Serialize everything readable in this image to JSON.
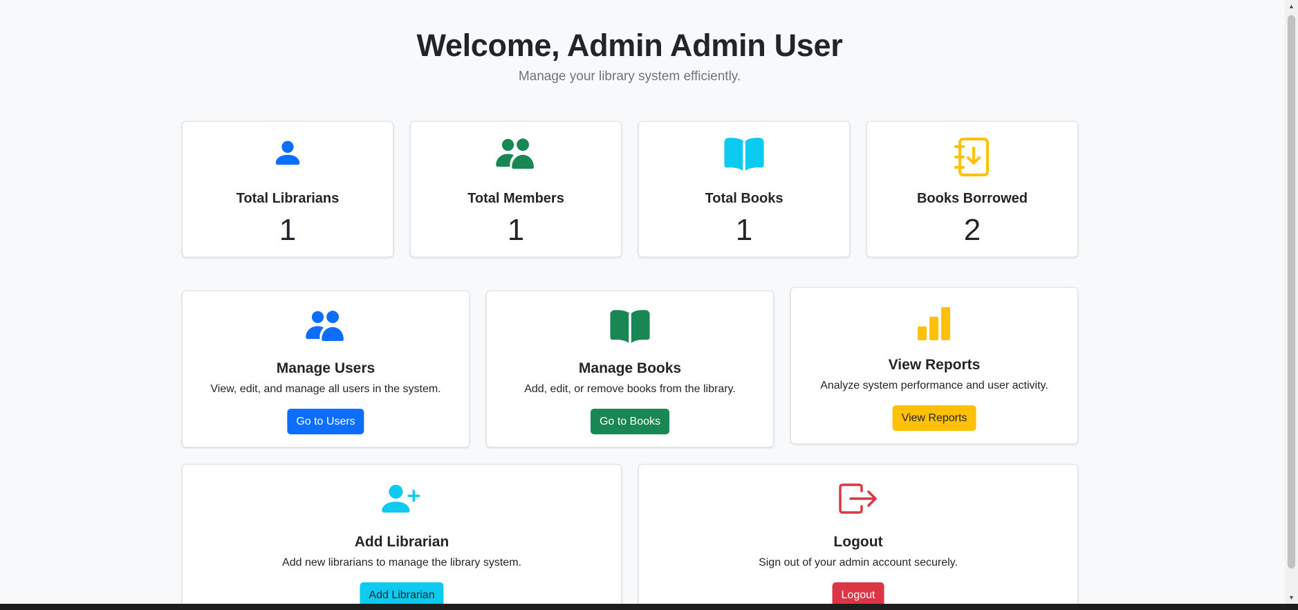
{
  "header": {
    "title": "Welcome, Admin Admin User",
    "subtitle": "Manage your library system efficiently."
  },
  "stats": [
    {
      "label": "Total Librarians",
      "value": "1",
      "icon": "person-icon",
      "color": "#0d6efd"
    },
    {
      "label": "Total Members",
      "value": "1",
      "icon": "people-icon",
      "color": "#198754"
    },
    {
      "label": "Total Books",
      "value": "1",
      "icon": "book-icon",
      "color": "#0dcaf0"
    },
    {
      "label": "Books Borrowed",
      "value": "2",
      "icon": "journal-arrow-down-icon",
      "color": "#ffc107"
    }
  ],
  "actions": [
    {
      "title": "Manage Users",
      "description": "View, edit, and manage all users in the system.",
      "button": "Go to Users",
      "icon": "people-icon",
      "color": "#0d6efd"
    },
    {
      "title": "Manage Books",
      "description": "Add, edit, or remove books from the library.",
      "button": "Go to Books",
      "icon": "book-icon",
      "color": "#198754"
    },
    {
      "title": "View Reports",
      "description": "Analyze system performance and user activity.",
      "button": "View Reports",
      "icon": "bar-chart-icon",
      "color": "#ffc107"
    },
    {
      "title": "Add Librarian",
      "description": "Add new librarians to manage the library system.",
      "button": "Add Librarian",
      "icon": "person-plus-icon",
      "color": "#0dcaf0"
    },
    {
      "title": "Logout",
      "description": "Sign out of your admin account securely.",
      "button": "Logout",
      "icon": "box-arrow-right-icon",
      "color": "#dc3545"
    }
  ]
}
